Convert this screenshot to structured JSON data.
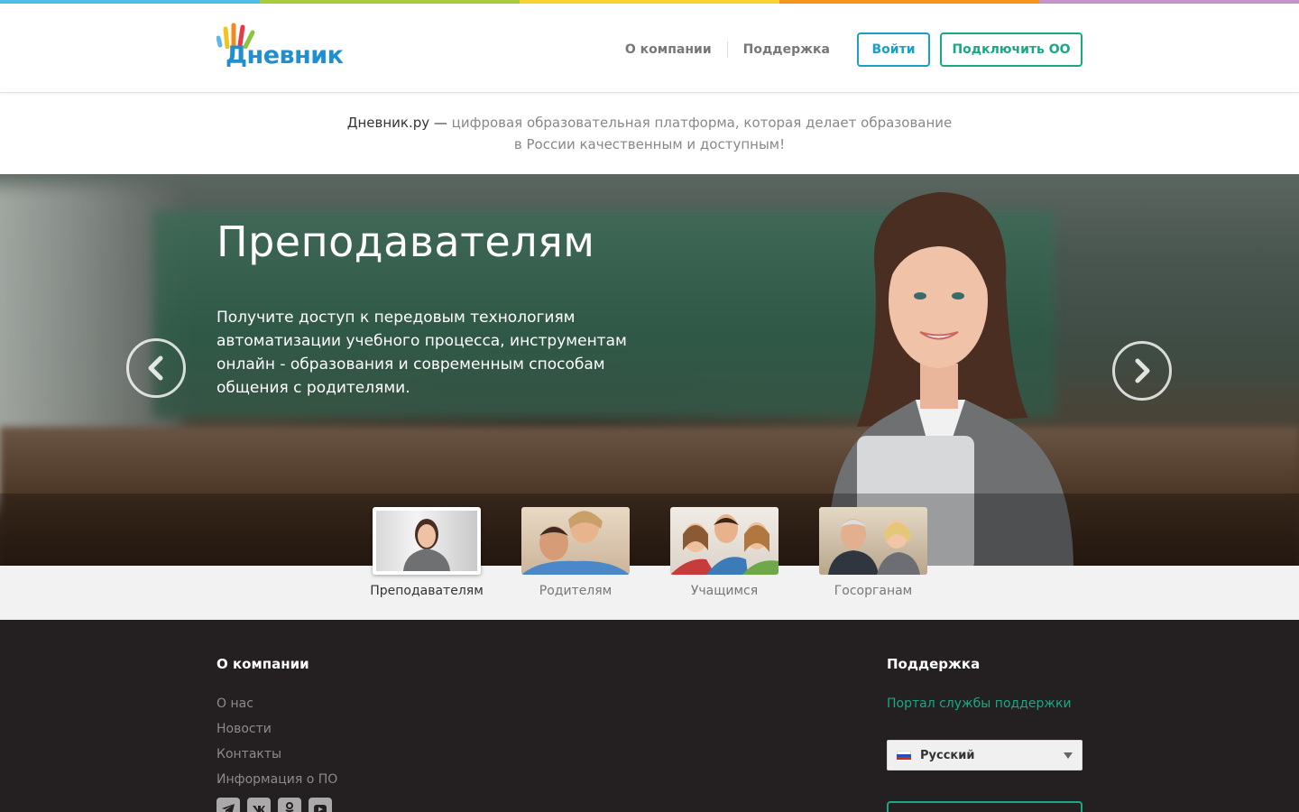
{
  "colors": {
    "stripe": [
      "#4fbde4",
      "#a6cc3a",
      "#fbd22f",
      "#f7941e",
      "#c694c8"
    ],
    "accent_blue": "#19a0c8",
    "accent_green": "#19a982",
    "footer_bg": "#241f20"
  },
  "header": {
    "logo_text": "Дневник",
    "nav": [
      {
        "label": "О компании"
      },
      {
        "label": "Поддержка"
      }
    ],
    "login_label": "Войти",
    "connect_label": "Подключить ОО"
  },
  "tagline": {
    "brand": "Дневник.ру —",
    "line1": "цифровая образовательная платформа, которая делает образование",
    "line2": "в России качественным и доступным!"
  },
  "hero": {
    "title": "Преподавателям",
    "text": "Получите доступ к передовым технологиям автоматизации учебного процесса, инструментам онлайн - образования и современным способам общения с родителями.",
    "prev_icon": "chevron-left-icon",
    "next_icon": "chevron-right-icon"
  },
  "tabs": [
    {
      "label": "Преподавателям",
      "active": true
    },
    {
      "label": "Родителям",
      "active": false
    },
    {
      "label": "Учащимся",
      "active": false
    },
    {
      "label": "Госорганам",
      "active": false
    }
  ],
  "footer": {
    "about_title": "О компании",
    "about_links": [
      "О нас",
      "Новости",
      "Контакты",
      "Информация о ПО"
    ],
    "social_icons": [
      "telegram-icon",
      "vk-icon",
      "odnoklassniki-icon",
      "youtube-icon"
    ],
    "support_title": "Поддержка",
    "support_link": "Портал службы поддержки",
    "language": "Русский"
  }
}
